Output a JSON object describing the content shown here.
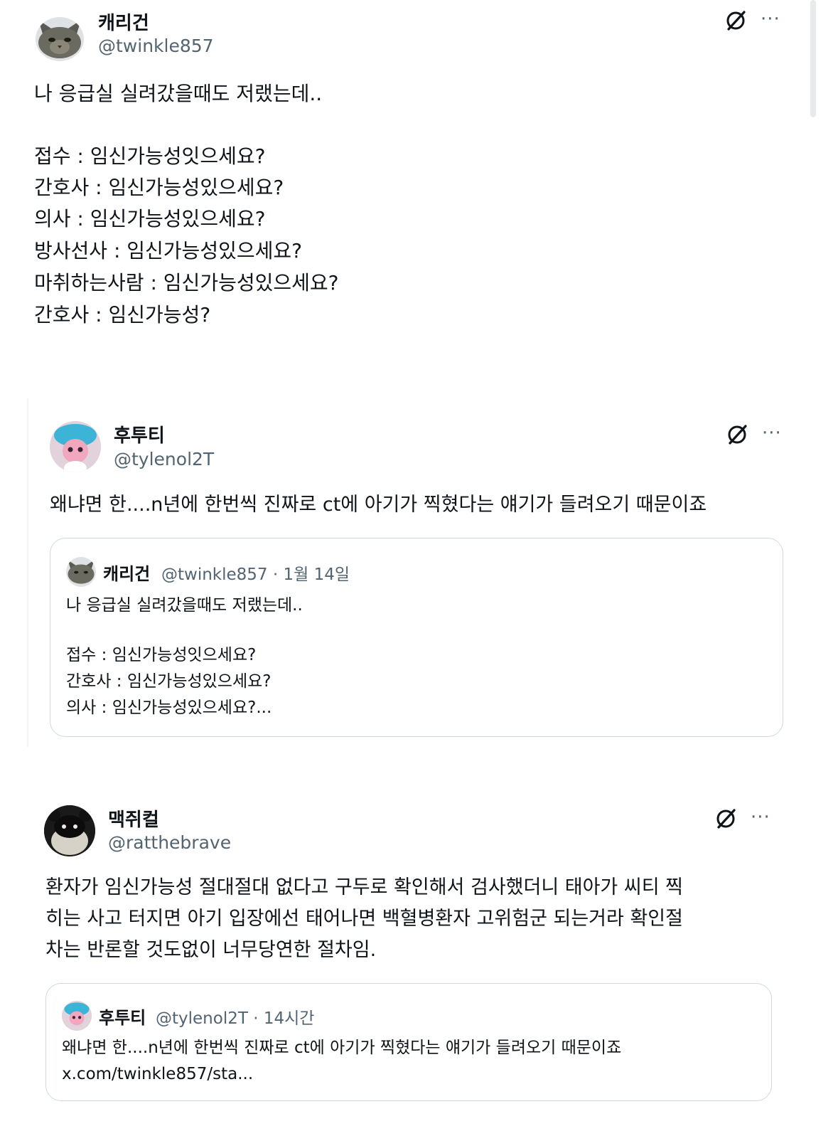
{
  "post1": {
    "name": "캐리건",
    "handle": "@twinkle857",
    "lines": [
      "나 응급실 실려갔을때도 저랬는데..",
      "",
      "접수 : 임신가능성잇으세요?",
      "간호사 : 임신가능성있으세요?",
      "의사 : 임신가능성있으세요?",
      "방사선사 : 임신가능성있으세요?",
      "마취하는사람 : 임신가능성있으세요?",
      "간호사 : 임신가능성?"
    ]
  },
  "post2": {
    "name": "후투티",
    "handle": "@tylenol2T",
    "text": "왜냐면 한....n년에 한번씩 진짜로 ct에 아기가 찍혔다는 얘기가 들려오기 때문이죠",
    "quote": {
      "name": "캐리건",
      "meta": "@twinkle857 · 1월 14일",
      "lines": [
        "나 응급실 실려갔을때도 저랬는데..",
        "",
        "접수 : 임신가능성잇으세요?",
        "간호사 : 임신가능성있으세요?",
        "의사 : 임신가능성있으세요?..."
      ]
    }
  },
  "post3": {
    "name": "맥쥐컬",
    "handle": "@ratthebrave",
    "lines": [
      "환자가 임신가능성 절대절대 없다고 구두로 확인해서 검사했더니 태아가 씨티 찍",
      "히는 사고 터지면 아기 입장에선 태어나면 백혈병환자 고위험군 되는거라 확인절",
      "차는 반론할 것도없이 너무당연한 절차임."
    ],
    "quote": {
      "name": "후투티",
      "meta": "@tylenol2T · 14시간",
      "lines": [
        "왜냐면 한....n년에 한번씩 진짜로 ct에 아기가 찍혔다는 얘기가 들려오기 때문이죠",
        "x.com/twinkle857/sta..."
      ]
    }
  },
  "icons": {
    "grok": "grok-icon",
    "more": "more-icon"
  },
  "more_glyph": "···"
}
